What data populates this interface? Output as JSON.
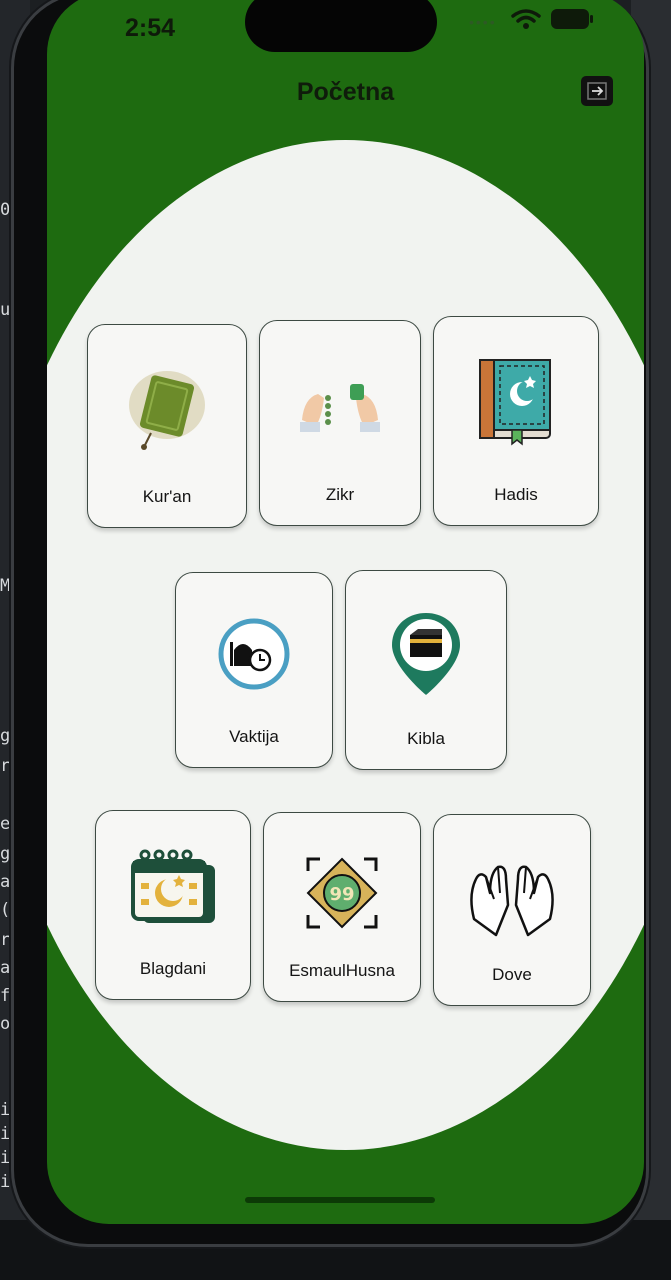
{
  "status_bar": {
    "time": "2:54",
    "dots": "••••"
  },
  "header": {
    "title": "Početna"
  },
  "colors": {
    "primary_green": "#1e6b10",
    "background": "#f1f3f0",
    "tile_border": "#3d4a43"
  },
  "menu": [
    {
      "label": "Kur'an",
      "icon": "quran-book-icon"
    },
    {
      "label": "Zikr",
      "icon": "prayer-beads-icon"
    },
    {
      "label": "Hadis",
      "icon": "hadith-book-icon"
    },
    {
      "label": "Vaktija",
      "icon": "prayer-time-clock-icon"
    },
    {
      "label": "Kibla",
      "icon": "kaaba-location-icon"
    },
    {
      "label": "Blagdani",
      "icon": "calendar-crescent-icon"
    },
    {
      "label": "EsmaulHusna",
      "icon": "99-names-icon"
    },
    {
      "label": "Dove",
      "icon": "praying-hands-icon"
    }
  ],
  "background_code": [
    "0",
    "0",
    "u",
    "M",
    "ga",
    "re",
    "e(",
    "gr",
    "ac",
    "(\"",
    "re",
    "as",
    "fr",
    "ov",
    "ifi",
    "ifi",
    "ifi",
    "ifi"
  ]
}
